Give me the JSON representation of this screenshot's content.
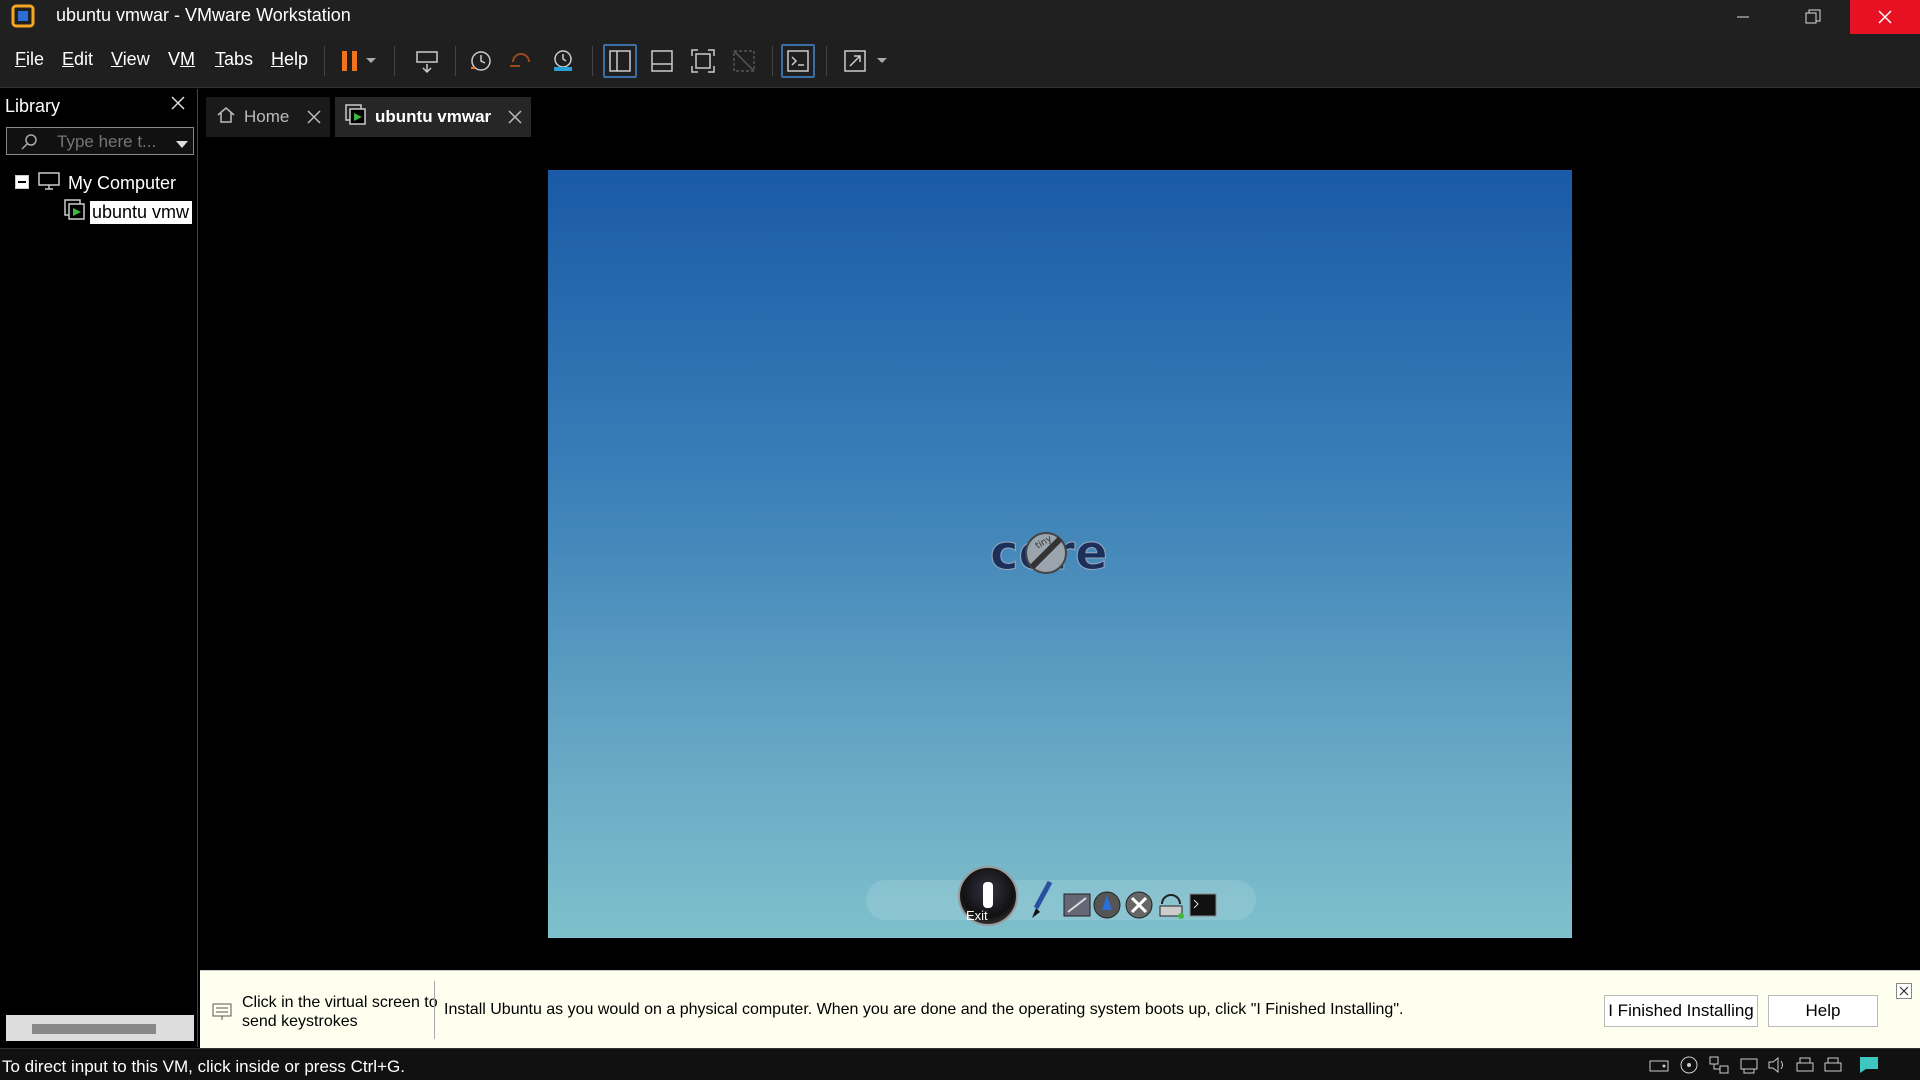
{
  "window": {
    "title": "ubuntu vmwar - VMware Workstation",
    "controls": [
      "minimize",
      "restore",
      "close"
    ]
  },
  "menu": {
    "items": [
      {
        "label": "File",
        "key": "F"
      },
      {
        "label": "Edit",
        "key": "E"
      },
      {
        "label": "View",
        "key": "V"
      },
      {
        "label": "VM",
        "key": "M"
      },
      {
        "label": "Tabs",
        "key": "T"
      },
      {
        "label": "Help",
        "key": "H"
      }
    ]
  },
  "toolbar": {
    "icons": [
      "pause-icon",
      "dropdown-icon",
      "send-ctrl-alt-del-icon",
      "snapshot-icon",
      "revert-snapshot-icon",
      "snapshot-manager-icon",
      "show-library-icon",
      "thumbnail-bar-icon",
      "full-screen-icon",
      "unity-icon",
      "console-view-icon",
      "stretch-icon",
      "dropdown-icon"
    ],
    "accent": "#f07320"
  },
  "library": {
    "title": "Library",
    "search_placeholder": "Type here t...",
    "tree": {
      "root": "My Computer",
      "vm": "ubuntu vmw"
    }
  },
  "tabs": [
    {
      "label": "Home",
      "active": false
    },
    {
      "label": "ubuntu vmwar",
      "active": true
    }
  ],
  "vm": {
    "logo_text": "core",
    "logo_small": "tiny",
    "dock": {
      "exit_label": "Exit"
    },
    "gradient": [
      "#1a5aa6",
      "#7ec1cc"
    ]
  },
  "hint": {
    "click_text": "Click in the virtual screen to send keystrokes",
    "install_text": "Install Ubuntu as you would on a physical computer. When you are done and the operating system boots up, click \"I Finished Installing\".",
    "finished_button": "I Finished Installing",
    "help_button": "Help"
  },
  "status": {
    "text": "To direct input to this VM, click inside or press Ctrl+G."
  }
}
